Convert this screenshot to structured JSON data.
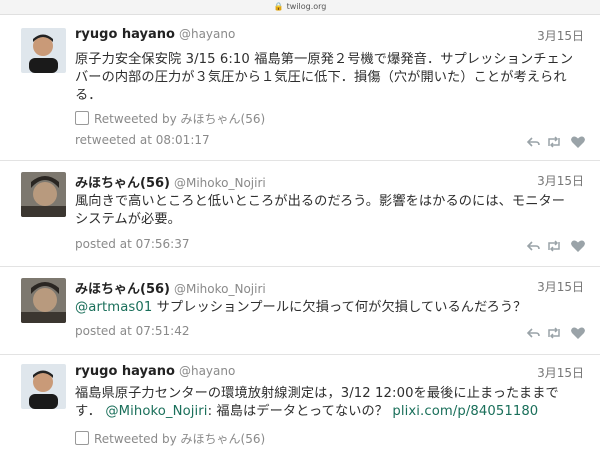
{
  "browser": {
    "url": "twilog.org"
  },
  "tweets": [
    {
      "user": "ryugo hayano",
      "handle": "@hayano",
      "date": "3月15日",
      "text": "原子力安全保安院 3/15 6:10 福島第一原発２号機で爆発音．サプレッションチェンバーの内部の圧力が３気圧から１気圧に低下．損傷（穴が開いた）ことが考えられる．",
      "retweet_label": "Retweeted by みほちゃん(56)",
      "meta": "retweeted at 08:01:17"
    },
    {
      "user": "みほちゃん(56)",
      "handle": "@Mihoko_Nojiri",
      "date": "3月15日",
      "text": "風向きで高いところと低いところが出るのだろう。影響をはかるのには、モニターシステムが必要。",
      "meta": "posted at 07:56:37"
    },
    {
      "user": "みほちゃん(56)",
      "handle": "@Mihoko_Nojiri",
      "date": "3月15日",
      "mention": "@artmas01",
      "text": " サプレッションプールに欠損って何が欠損しているんだろう？",
      "meta": "posted at 07:51:42"
    },
    {
      "user": "ryugo hayano",
      "handle": "@hayano",
      "date": "3月15日",
      "text_a": "福島県原子力センターの環境放射線測定は，3/12 12:00を最後に止まったままです．",
      "mention": "@Mihoko_Nojiri",
      "text_b": ": 福島はデータとってないの？ ",
      "link": "plixi.com/p/84051180",
      "retweet_label": "Retweeted by みほちゃん(56)"
    }
  ],
  "icons": {
    "reply": "reply-icon",
    "retweet": "retweet-icon",
    "favorite": "heart-icon",
    "lock": "lock-icon"
  },
  "colors": {
    "link": "#1a6f5a",
    "meta": "#8a8a8a",
    "icon": "#9aa3a8"
  }
}
